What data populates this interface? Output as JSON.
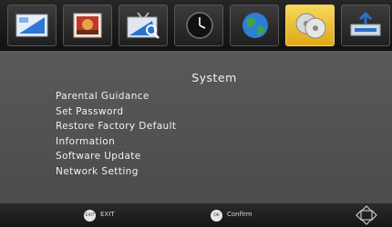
{
  "tabs": [
    {
      "icon": "picture-settings-icon",
      "active": false
    },
    {
      "icon": "image-icon",
      "active": false
    },
    {
      "icon": "channel-search-icon",
      "active": false
    },
    {
      "icon": "clock-icon",
      "active": false
    },
    {
      "icon": "globe-icon",
      "active": false
    },
    {
      "icon": "system-disc-icon",
      "active": true
    },
    {
      "icon": "usb-icon",
      "active": false
    }
  ],
  "page": {
    "title": "System"
  },
  "menu": {
    "items": [
      "Parental Guidance",
      "Set Password",
      "Restore Factory Default",
      "Information",
      "Software Update",
      "Network Setting"
    ]
  },
  "footer": {
    "exit": {
      "button": "EXIT",
      "label": "EXIT"
    },
    "confirm": {
      "button": "OK",
      "label": "Confirm"
    }
  },
  "colors": {
    "active_tab": "#f2c436",
    "background": "#505050"
  }
}
